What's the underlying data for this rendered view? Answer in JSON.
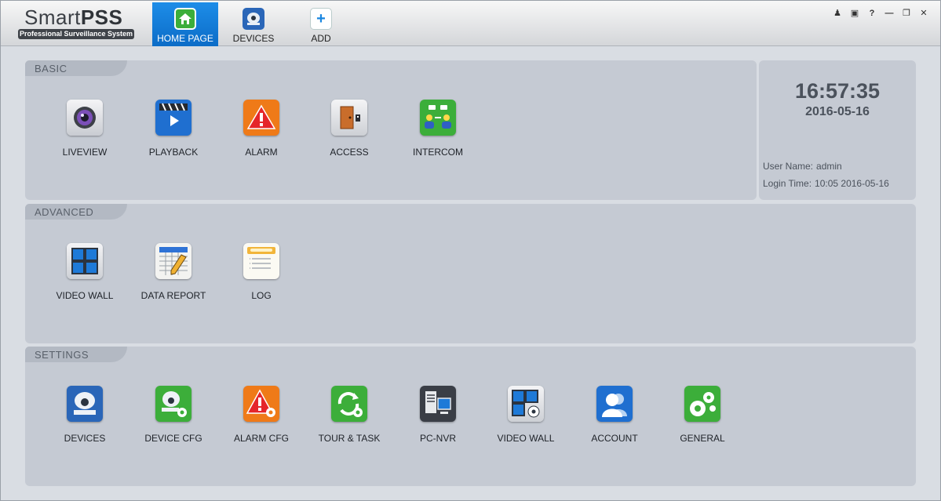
{
  "app": {
    "title_thin": "Smart",
    "title_bold": "PSS",
    "subtitle": "Professional Surveillance System"
  },
  "nav": [
    {
      "label": "HOME PAGE",
      "icon": "home-icon"
    },
    {
      "label": "DEVICES",
      "icon": "camera-icon"
    },
    {
      "label": "ADD",
      "icon": "plus-icon"
    }
  ],
  "window_controls": [
    "user-icon",
    "lock-icon",
    "help-icon",
    "minimize-icon",
    "restore-icon",
    "close-icon"
  ],
  "basic": {
    "heading": "BASIC",
    "items": [
      {
        "label": "LIVEVIEW",
        "icon": "liveview-icon"
      },
      {
        "label": "PLAYBACK",
        "icon": "playback-icon"
      },
      {
        "label": "ALARM",
        "icon": "alarm-icon"
      },
      {
        "label": "ACCESS",
        "icon": "access-icon"
      },
      {
        "label": "INTERCOM",
        "icon": "intercom-icon"
      }
    ]
  },
  "advanced": {
    "heading": "ADVANCED",
    "items": [
      {
        "label": "VIDEO WALL",
        "icon": "video-wall-icon"
      },
      {
        "label": "DATA REPORT",
        "icon": "data-report-icon"
      },
      {
        "label": "LOG",
        "icon": "log-icon"
      }
    ]
  },
  "settings": {
    "heading": "SETTINGS",
    "items": [
      {
        "label": "DEVICES",
        "icon": "devices-icon"
      },
      {
        "label": "DEVICE CFG",
        "icon": "device-cfg-icon"
      },
      {
        "label": "ALARM CFG",
        "icon": "alarm-cfg-icon"
      },
      {
        "label": "TOUR & TASK",
        "icon": "tour-task-icon"
      },
      {
        "label": "PC-NVR",
        "icon": "pc-nvr-icon"
      },
      {
        "label": "VIDEO WALL",
        "icon": "video-wall-cfg-icon"
      },
      {
        "label": "ACCOUNT",
        "icon": "account-icon"
      },
      {
        "label": "GENERAL",
        "icon": "general-icon"
      }
    ]
  },
  "status": {
    "time": "16:57:35",
    "date": "2016-05-16",
    "user_label": "User Name:",
    "user_value": "admin",
    "login_label": "Login Time:",
    "login_value": "10:05 2016-05-16"
  },
  "colors": {
    "accent": "#1a86e0",
    "panel": "#c5cad3"
  }
}
